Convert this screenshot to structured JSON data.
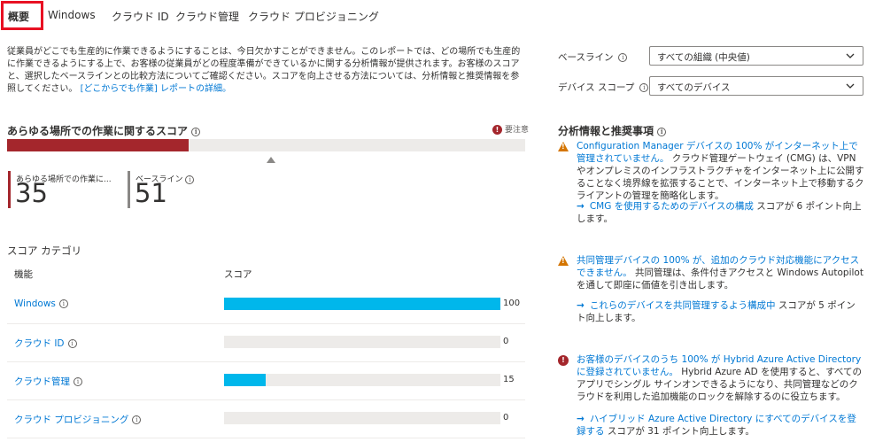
{
  "tabs": [
    {
      "label": "概要"
    },
    {
      "label": "Windows"
    },
    {
      "label": "クラウド ID"
    },
    {
      "label": "クラウド管理"
    },
    {
      "label": "クラウド プロビジョニング"
    }
  ],
  "description": {
    "text": "従業員がどこでも生産的に作業できるようにすることは、今日欠かすことができません。このレポートでは、どの場所でも生産的に作業できるようにする上で、お客様の従業員がどの程度準備ができているかに関する分析情報が提供されます。お客様のスコアと、選択したベースラインとの比較方法についてご確認ください。スコアを向上させる方法については、分析情報と推奨情報を参照してください。",
    "link": "[どこからでも作業] レポートの詳細。"
  },
  "filters": {
    "baseline_label": "ベースライン",
    "baseline_value": "すべての組織 (中央値)",
    "device_scope_label": "デバイス スコープ",
    "device_scope_value": "すべてのデバイス"
  },
  "score": {
    "title": "あらゆる場所での作業に関するスコア",
    "status": "要注意",
    "value_label": "あらゆる場所での作業に...",
    "value": "35",
    "baseline_label": "ベースライン",
    "baseline_value": "51",
    "score_fraction": 0.35,
    "baseline_fraction": 0.51,
    "colors": {
      "score": "#a4262c",
      "baseline": "#8a8886"
    }
  },
  "categories": {
    "title": "スコア カテゴリ",
    "col_feature": "機能",
    "col_score": "スコア",
    "rows": [
      {
        "name": "Windows",
        "value": "100",
        "fraction": 1.0
      },
      {
        "name": "クラウド ID",
        "value": "0",
        "fraction": 0.0
      },
      {
        "name": "クラウド管理",
        "value": "15",
        "fraction": 0.15
      },
      {
        "name": "クラウド プロビジョニング",
        "value": "0",
        "fraction": 0.0
      }
    ]
  },
  "insights": {
    "title": "分析情報と推奨事項",
    "items": [
      {
        "severity": "warning",
        "lead": "Configuration Manager デバイスの 100% がインターネット上で管理されていません。",
        "text": "クラウド管理ゲートウェイ (CMG) は、VPN やオンプレミスのインフラストラクチャをインターネット上に公開することなく境界線を拡張することで、インターネット上で移動するクライアントの管理を簡略化します。",
        "action_link": "CMG を使用するためのデバイスの構成",
        "action_text": "スコアが 6 ポイント向上します。"
      },
      {
        "severity": "warning",
        "lead": "共同管理デバイスの 100% が、追加のクラウド対応機能にアクセスできません。",
        "text": "共同管理は、条件付きアクセスと Windows Autopilot を通して即座に価値を引き出します。",
        "action_link": "これらのデバイスを共同管理するよう構成中",
        "action_text": "スコアが 5 ポイント向上します。"
      },
      {
        "severity": "error",
        "lead": "お客様のデバイスのうち 100% が Hybrid Azure Active Directory に登録されていません。",
        "text": "Hybrid Azure AD を使用すると、すべてのアプリでシングル サインオンできるようになり、共同管理などのクラウドを利用した追加機能のロックを解除するのに役立ちます。",
        "action_link": "ハイブリッド Azure Active Directory にすべてのデバイスを登録する",
        "action_text": "スコアが 31 ポイント向上します。"
      }
    ]
  },
  "icons": {
    "info": "info-icon",
    "chevron": "chevron-down-icon",
    "warning": "warning-triangle-icon",
    "error": "error-circle-icon",
    "arrow": "arrow-right-icon"
  }
}
